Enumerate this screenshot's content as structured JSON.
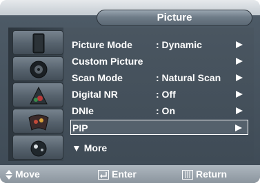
{
  "title": "Picture",
  "side_icons": [
    "setup-icon",
    "sound-icon",
    "channel-icon",
    "picture-icon",
    "input-icon"
  ],
  "menu": {
    "items": [
      {
        "label": "Picture Mode",
        "value": ": Dynamic",
        "arrow": true
      },
      {
        "label": "Custom Picture",
        "value": "",
        "arrow": true
      },
      {
        "label": "Scan Mode",
        "value": ": Natural Scan",
        "arrow": true
      },
      {
        "label": "Digital NR",
        "value": ": Off",
        "arrow": true
      },
      {
        "label": "DNIe",
        "value": ": On",
        "arrow": true
      },
      {
        "label": "PIP",
        "value": "",
        "arrow": true,
        "selected": true
      },
      {
        "label": "▼ More",
        "value": "",
        "arrow": false
      }
    ]
  },
  "help": {
    "move": "Move",
    "enter": "Enter",
    "return": "Return"
  },
  "colors": {
    "panel": "#3f4b56",
    "highlight_border": "#ffffff",
    "text": "#ffffff"
  }
}
